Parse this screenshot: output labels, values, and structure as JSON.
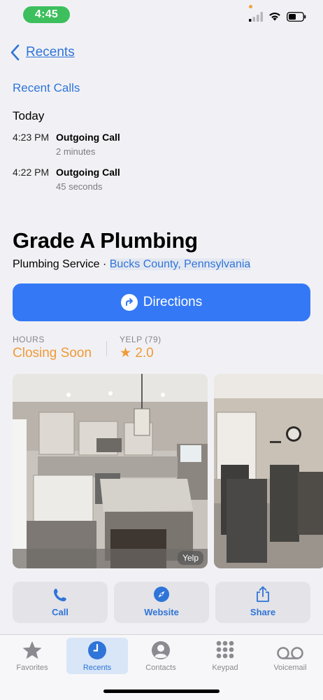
{
  "status_bar": {
    "time": "4:45"
  },
  "nav": {
    "back_label": "Recents"
  },
  "recent_calls": {
    "title": "Recent Calls",
    "day": "Today",
    "calls": [
      {
        "time": "4:23 PM",
        "type": "Outgoing Call",
        "duration": "2 minutes"
      },
      {
        "time": "4:22 PM",
        "type": "Outgoing Call",
        "duration": "45 seconds"
      }
    ]
  },
  "business": {
    "name": "Grade A Plumbing",
    "category": "Plumbing Service · ",
    "location": "Bucks County, Pennsylvania",
    "directions_label": "Directions",
    "hours_label": "HOURS",
    "hours_value": "Closing Soon",
    "yelp_label": "YELP (79)",
    "rating_star": "★",
    "rating_value": "2.0",
    "photo_source": "Yelp"
  },
  "actions": [
    {
      "label": "Call",
      "icon": "phone-icon"
    },
    {
      "label": "Website",
      "icon": "compass-icon"
    },
    {
      "label": "Share",
      "icon": "share-icon"
    }
  ],
  "tabs": [
    {
      "label": "Favorites",
      "icon": "star-icon"
    },
    {
      "label": "Recents",
      "icon": "clock-icon",
      "active": true
    },
    {
      "label": "Contacts",
      "icon": "person-icon"
    },
    {
      "label": "Keypad",
      "icon": "keypad-icon"
    },
    {
      "label": "Voicemail",
      "icon": "voicemail-icon"
    }
  ],
  "colors": {
    "accent": "#3478f6",
    "link": "#2f74d8",
    "warning": "#f09a37",
    "time_pill": "#3cbf5c"
  }
}
